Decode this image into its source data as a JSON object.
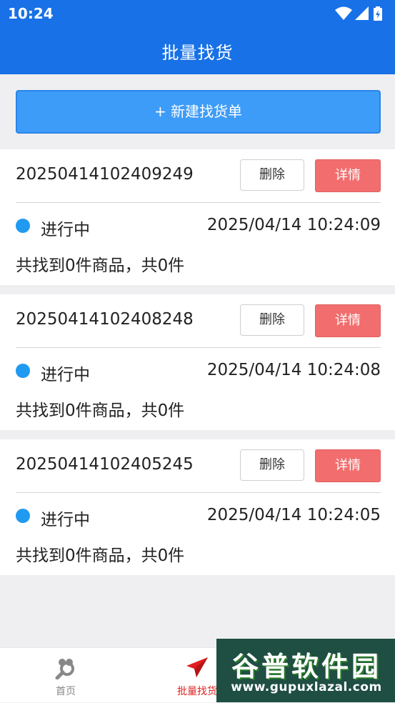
{
  "status_bar": {
    "time": "10:24"
  },
  "header": {
    "title": "批量找货"
  },
  "new_order_button": {
    "label": "+ 新建找货单"
  },
  "orders": [
    {
      "id": "20250414102409249",
      "delete_label": "删除",
      "detail_label": "详情",
      "status": "进行中",
      "time": "2025/04/14 10:24:09",
      "summary": "共找到0件商品，共0件"
    },
    {
      "id": "20250414102408248",
      "delete_label": "删除",
      "detail_label": "详情",
      "status": "进行中",
      "time": "2025/04/14 10:24:08",
      "summary": "共找到0件商品，共0件"
    },
    {
      "id": "20250414102405245",
      "delete_label": "删除",
      "detail_label": "详情",
      "status": "进行中",
      "time": "2025/04/14 10:24:05",
      "summary": "共找到0件商品，共0件"
    }
  ],
  "tabs": [
    {
      "label": "首页",
      "icon": "search-home-icon",
      "active": false
    },
    {
      "label": "批量找货",
      "icon": "paper-plane-icon",
      "active": true
    }
  ],
  "watermark": {
    "title": "谷普软件园",
    "url": "www.gupuxlazal.com"
  },
  "colors": {
    "header": "#1871e6",
    "primary_button": "#3e9cf9",
    "detail_button": "#f26e6e",
    "status_dot": "#1f9af0",
    "active_tab": "#e02020"
  }
}
